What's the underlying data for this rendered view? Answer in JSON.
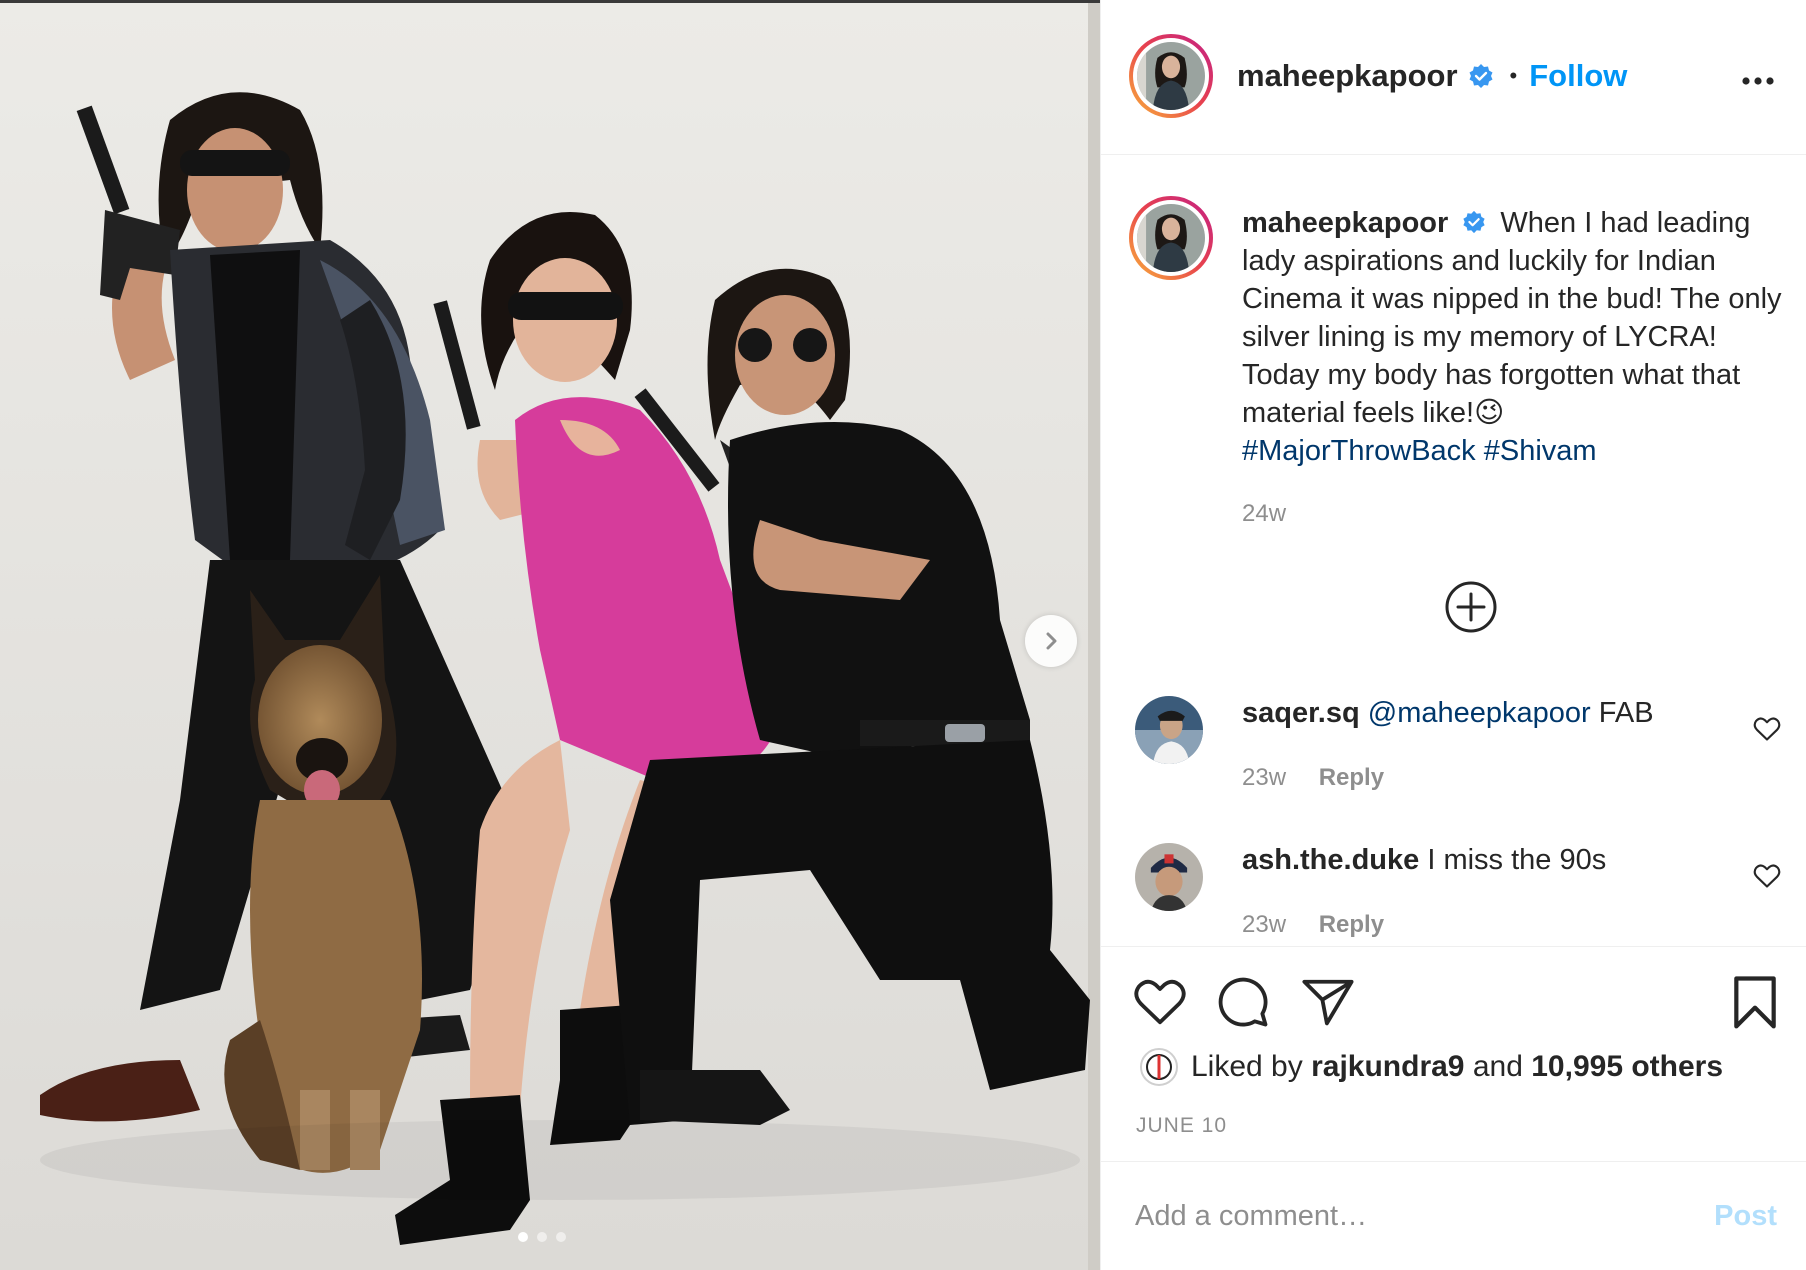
{
  "post": {
    "author": "maheepkapoor",
    "follow_label": "Follow",
    "dot_separator": "•",
    "more_icon": "more-horizontal-icon",
    "verified_icon": "verified-badge-icon",
    "photo": {
      "next_icon": "chevron-right-icon",
      "carousel_count": 3,
      "active_index": 0
    }
  },
  "caption": {
    "author": "maheepkapoor",
    "text": "When I had leading lady aspirations and luckily for Indian Cinema it was nipped in the bud! The only silver lining is my memory of LYCRA! Today my body has forgotten what that material feels like!😉",
    "hashtags": "#MajorThrowBack #Shivam",
    "time": "24w"
  },
  "load_more_icon": "plus-circle-icon",
  "comments": [
    {
      "user": "saqer.sq",
      "mention": "@maheepkapoor",
      "text": "FAB",
      "time": "23w",
      "reply_label": "Reply"
    },
    {
      "user": "ash.the.duke",
      "mention": "",
      "text": "I miss the 90s",
      "time": "23w",
      "reply_label": "Reply"
    }
  ],
  "actions": {
    "like_icon": "heart-icon",
    "comment_icon": "comment-bubble-icon",
    "share_icon": "paper-plane-icon",
    "save_icon": "bookmark-icon"
  },
  "likes": {
    "prefix": "Liked by",
    "user": "rajkundra9",
    "conjunction": "and",
    "count": "10,995 others"
  },
  "date": "JUNE 10",
  "add_comment": {
    "placeholder": "Add a comment…",
    "post_label": "Post"
  },
  "colors": {
    "link_blue": "#0095f6",
    "hashtag_blue": "#00376b",
    "muted": "#8e8e8e",
    "text": "#262626",
    "post_disabled": "#b2dffc",
    "dress_pink": "#d63c9b"
  }
}
